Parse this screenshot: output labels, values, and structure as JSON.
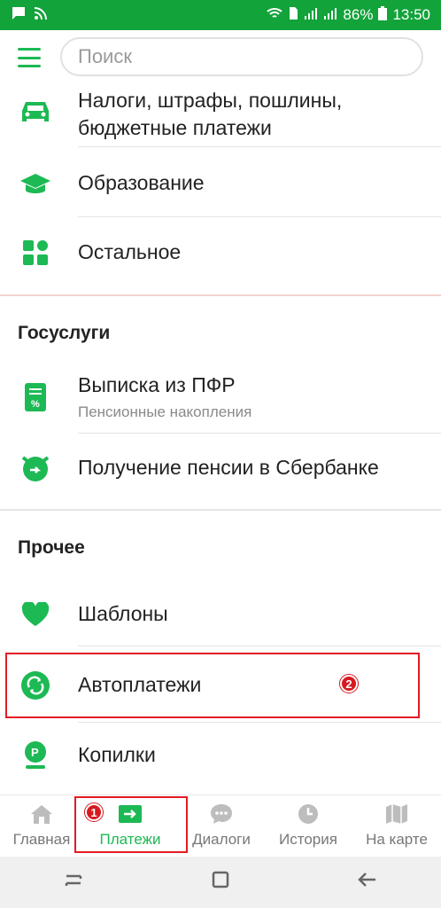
{
  "status_bar": {
    "battery": "86%",
    "time": "13:50"
  },
  "search": {
    "placeholder": "Поиск"
  },
  "items": [
    {
      "label": "Налоги, штрафы, пошлины, бюджетные платежи",
      "icon": "car-icon"
    },
    {
      "label": "Образование",
      "icon": "graduation-cap-icon"
    },
    {
      "label": "Остальное",
      "icon": "grid-icon"
    }
  ],
  "gosuslugi": {
    "title": "Госуслуги",
    "items": [
      {
        "label": "Выписка из ПФР",
        "sublabel": "Пенсионные накопления",
        "icon": "document-percent-icon"
      },
      {
        "label": "Получение пенсии в Сбербанке",
        "icon": "pension-icon"
      }
    ]
  },
  "prochee": {
    "title": "Прочее",
    "items": [
      {
        "label": "Шаблоны",
        "icon": "heart-icon"
      },
      {
        "label": "Автоплатежи",
        "icon": "autopay-icon"
      },
      {
        "label": "Копилки",
        "icon": "piggy-bank-icon"
      }
    ]
  },
  "annotations": {
    "badge1": "1",
    "badge2": "2"
  },
  "bottom_nav": [
    {
      "label": "Главная",
      "icon": "home-icon"
    },
    {
      "label": "Платежи",
      "icon": "payments-icon",
      "active": true
    },
    {
      "label": "Диалоги",
      "icon": "chat-icon"
    },
    {
      "label": "История",
      "icon": "clock-icon"
    },
    {
      "label": "На карте",
      "icon": "map-icon"
    }
  ],
  "colors": {
    "accent": "#1db954",
    "status_bar": "#12a33a",
    "annotation_red": "#e31b23"
  }
}
